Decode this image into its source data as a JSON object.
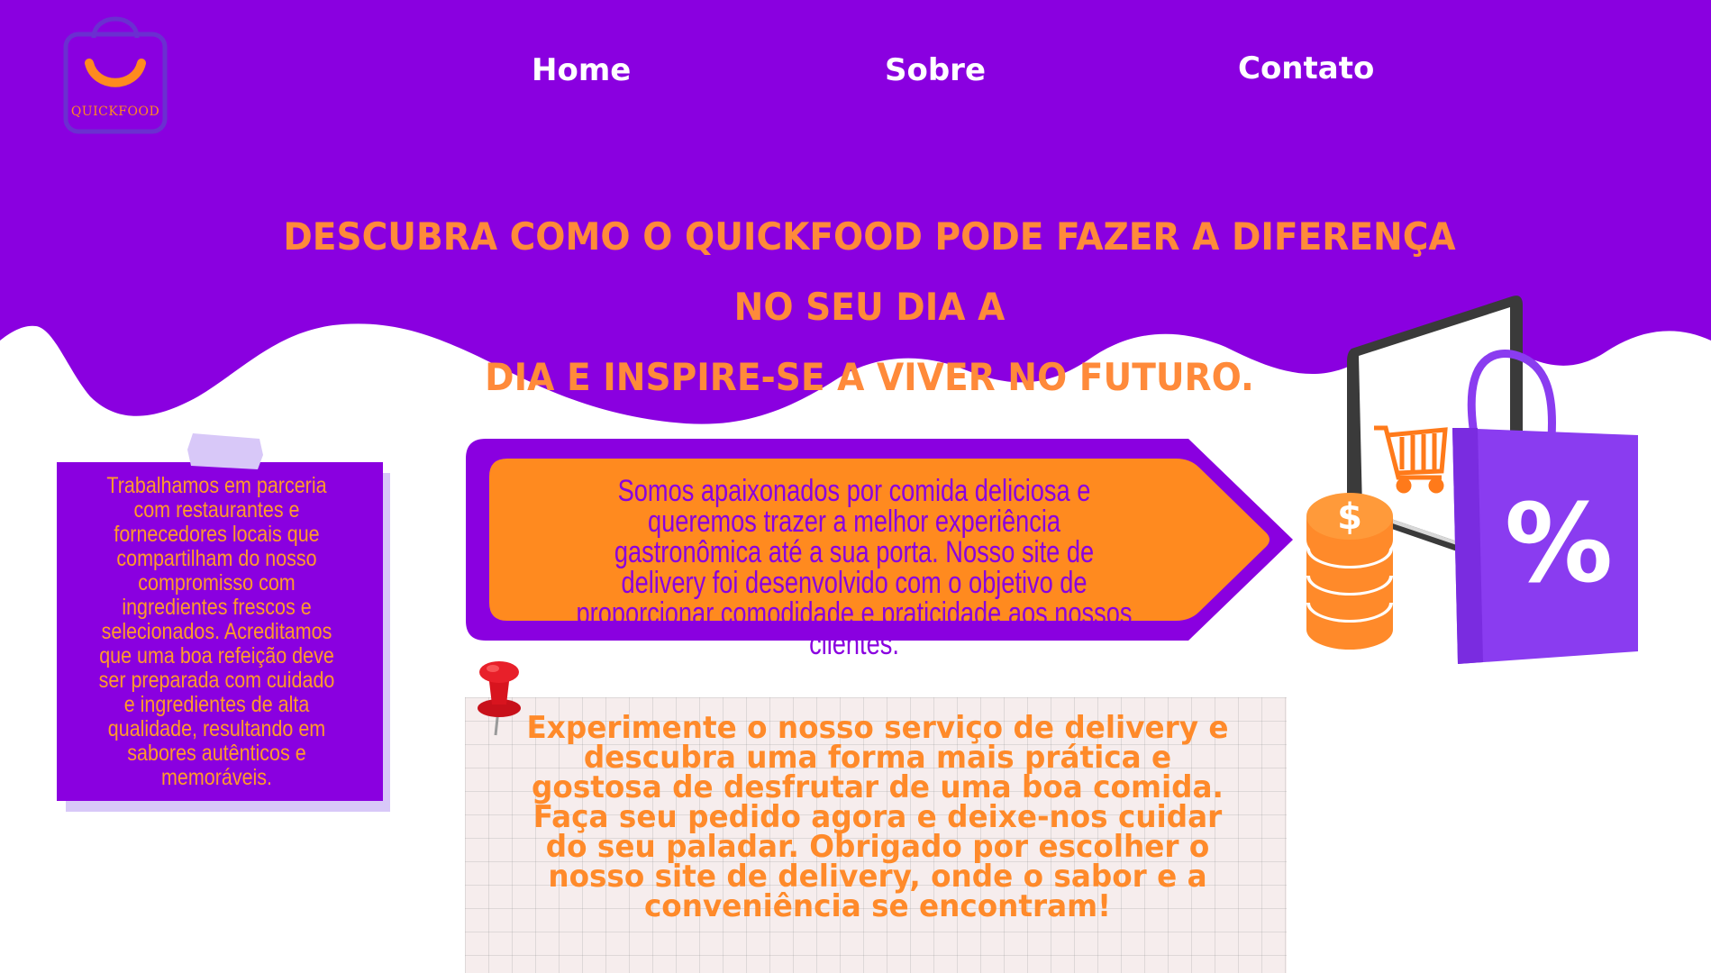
{
  "logo": {
    "text": "QUICKFOOD",
    "icon": "smile-shopping-bag-icon"
  },
  "nav": [
    {
      "label": "Home"
    },
    {
      "label": "Sobre"
    },
    {
      "label": "Contato"
    }
  ],
  "headline": {
    "line1": "Descubra como o QuickFood pode fazer a diferença no seu dia a",
    "line2": "dia e inspire-se a viver no futuro."
  },
  "note": {
    "text": "Trabalhamos em parceria com restaurantes e fornecedores locais que compartilham do nosso compromisso com ingredientes frescos e selecionados. Acreditamos que uma boa refeição deve ser preparada com cuidado e ingredientes de alta qualidade, resultando em sabores autênticos e memoráveis."
  },
  "banner": {
    "text": "Somos apaixonados por comida deliciosa e queremos trazer a melhor experiência gastronômica até a sua porta. Nosso site de delivery foi desenvolvido com o objetivo de proporcionar comodidade e praticidade aos nossos clientes."
  },
  "paper": {
    "text": "Experimente o nosso serviço de delivery e descubra uma forma mais prática e gostosa de desfrutar de uma boa comida. Faça seu pedido agora e deixe-nos cuidar do seu paladar. Obrigado por escolher o nosso site de delivery, onde o sabor e a conveniência se encontram!"
  },
  "illustration": {
    "percent": "%",
    "coin_symbol": "$"
  },
  "colors": {
    "purple": "#8a00e0",
    "orange": "#ff8a2a",
    "lavender": "#d8c8f8",
    "paper": "#f6eded"
  }
}
